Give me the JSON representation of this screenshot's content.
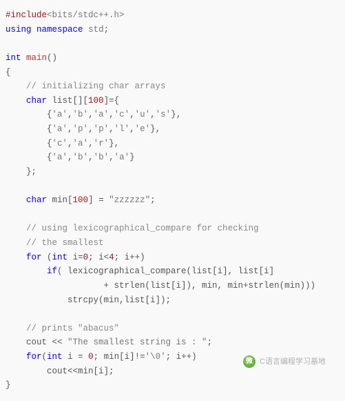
{
  "code": {
    "tokens": [
      [
        [
          "pp",
          "#include"
        ],
        [
          "hdr",
          "<bits/stdc++.h>"
        ]
      ],
      [
        [
          "kw",
          "using"
        ],
        [
          "plain",
          " "
        ],
        [
          "kw",
          "namespace"
        ],
        [
          "plain",
          " "
        ],
        [
          "ns",
          "std"
        ],
        [
          "plain",
          ";"
        ]
      ],
      [],
      [
        [
          "kw",
          "int"
        ],
        [
          "plain",
          " "
        ],
        [
          "fn",
          "main"
        ],
        [
          "plain",
          "()"
        ]
      ],
      [
        [
          "plain",
          "{"
        ]
      ],
      [
        [
          "plain",
          "    "
        ],
        [
          "cmt",
          "// initializing char arrays"
        ]
      ],
      [
        [
          "plain",
          "    "
        ],
        [
          "kw",
          "char"
        ],
        [
          "plain",
          " list[]["
        ],
        [
          "num",
          "100"
        ],
        [
          "plain",
          "]={"
        ]
      ],
      [
        [
          "plain",
          "        {"
        ],
        [
          "ch",
          "'a'"
        ],
        [
          "plain",
          ","
        ],
        [
          "ch",
          "'b'"
        ],
        [
          "plain",
          ","
        ],
        [
          "ch",
          "'a'"
        ],
        [
          "plain",
          ","
        ],
        [
          "ch",
          "'c'"
        ],
        [
          "plain",
          ","
        ],
        [
          "ch",
          "'u'"
        ],
        [
          "plain",
          ","
        ],
        [
          "ch",
          "'s'"
        ],
        [
          "plain",
          "},"
        ]
      ],
      [
        [
          "plain",
          "        {"
        ],
        [
          "ch",
          "'a'"
        ],
        [
          "plain",
          ","
        ],
        [
          "ch",
          "'p'"
        ],
        [
          "plain",
          ","
        ],
        [
          "ch",
          "'p'"
        ],
        [
          "plain",
          ","
        ],
        [
          "ch",
          "'l'"
        ],
        [
          "plain",
          ","
        ],
        [
          "ch",
          "'e'"
        ],
        [
          "plain",
          "},"
        ]
      ],
      [
        [
          "plain",
          "        {"
        ],
        [
          "ch",
          "'c'"
        ],
        [
          "plain",
          ","
        ],
        [
          "ch",
          "'a'"
        ],
        [
          "plain",
          ","
        ],
        [
          "ch",
          "'r'"
        ],
        [
          "plain",
          "},"
        ]
      ],
      [
        [
          "plain",
          "        {"
        ],
        [
          "ch",
          "'a'"
        ],
        [
          "plain",
          ","
        ],
        [
          "ch",
          "'b'"
        ],
        [
          "plain",
          ","
        ],
        [
          "ch",
          "'b'"
        ],
        [
          "plain",
          ","
        ],
        [
          "ch",
          "'a'"
        ],
        [
          "plain",
          "}"
        ]
      ],
      [
        [
          "plain",
          "    };"
        ]
      ],
      [],
      [
        [
          "plain",
          "    "
        ],
        [
          "kw",
          "char"
        ],
        [
          "plain",
          " min["
        ],
        [
          "num",
          "100"
        ],
        [
          "plain",
          "] = "
        ],
        [
          "str",
          "\"zzzzzz\""
        ],
        [
          "plain",
          ";"
        ]
      ],
      [],
      [
        [
          "plain",
          "    "
        ],
        [
          "cmt",
          "// using lexicographical_compare for checking"
        ]
      ],
      [
        [
          "plain",
          "    "
        ],
        [
          "cmt",
          "// the smallest"
        ]
      ],
      [
        [
          "plain",
          "    "
        ],
        [
          "kw",
          "for"
        ],
        [
          "plain",
          " ("
        ],
        [
          "kw",
          "int"
        ],
        [
          "plain",
          " i="
        ],
        [
          "num",
          "0"
        ],
        [
          "plain",
          "; i<"
        ],
        [
          "num",
          "4"
        ],
        [
          "plain",
          "; i++)"
        ]
      ],
      [
        [
          "plain",
          "        "
        ],
        [
          "kw",
          "if"
        ],
        [
          "plain",
          "( lexicographical_compare(list[i], list[i]"
        ]
      ],
      [
        [
          "plain",
          "                   + strlen(list[i]), min, min+strlen(min)))"
        ]
      ],
      [
        [
          "plain",
          "            strcpy(min,list[i]);"
        ]
      ],
      [],
      [
        [
          "plain",
          "    "
        ],
        [
          "cmt",
          "// prints \"abacus\""
        ]
      ],
      [
        [
          "plain",
          "    cout << "
        ],
        [
          "str",
          "\"The smallest string is : \""
        ],
        [
          "plain",
          ";"
        ]
      ],
      [
        [
          "plain",
          "    "
        ],
        [
          "kw",
          "for"
        ],
        [
          "plain",
          "("
        ],
        [
          "kw",
          "int"
        ],
        [
          "plain",
          " i = "
        ],
        [
          "num",
          "0"
        ],
        [
          "plain",
          "; min[i]!="
        ],
        [
          "ch",
          "'\\0'"
        ],
        [
          "plain",
          "; i++)"
        ]
      ],
      [
        [
          "plain",
          "        cout<<min[i];"
        ]
      ],
      [
        [
          "plain",
          "}"
        ]
      ]
    ]
  },
  "watermark": {
    "logo_letter": "微",
    "text": "C语言编程学习基地"
  }
}
